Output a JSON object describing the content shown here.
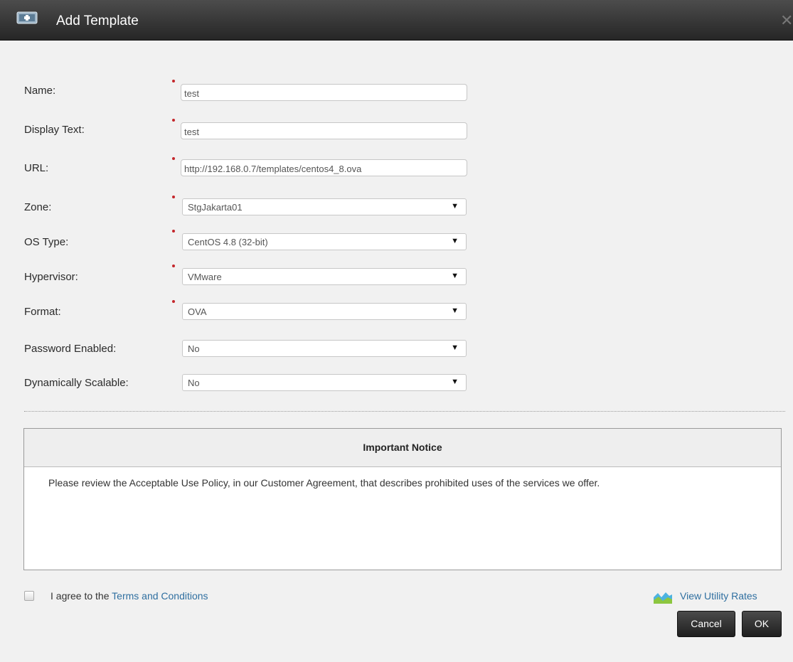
{
  "dialog": {
    "title": "Add Template"
  },
  "form": {
    "name_label": "Name:",
    "name_value": "test",
    "display_text_label": "Display Text:",
    "display_text_value": "test",
    "url_label": "URL:",
    "url_value": "http://192.168.0.7/templates/centos4_8.ova",
    "zone_label": "Zone:",
    "zone_value": "StgJakarta01",
    "os_type_label": "OS Type:",
    "os_type_value": "CentOS 4.8 (32-bit)",
    "hypervisor_label": "Hypervisor:",
    "hypervisor_value": "VMware",
    "format_label": "Format:",
    "format_value": "OVA",
    "password_label": "Password Enabled:",
    "password_value": "No",
    "scalable_label": "Dynamically Scalable:",
    "scalable_value": "No"
  },
  "notice": {
    "header": "Important Notice",
    "body": "Please review the Acceptable Use Policy, in our Customer Agreement, that describes prohibited uses of the services we offer."
  },
  "agreement": {
    "checked": false,
    "prefix": "I agree to the",
    "link_text": "Terms and Conditions"
  },
  "rates_link": "View Utility Rates",
  "buttons": {
    "cancel": "Cancel",
    "ok": "OK"
  },
  "icons": {
    "title": "template-add-icon",
    "close": "close-icon",
    "rates": "chart-icon",
    "dropdown": "chevron-down-icon"
  },
  "colors": {
    "titlebar": "#333333",
    "required_marker": "#c4262b",
    "link": "#2f6fa0"
  }
}
